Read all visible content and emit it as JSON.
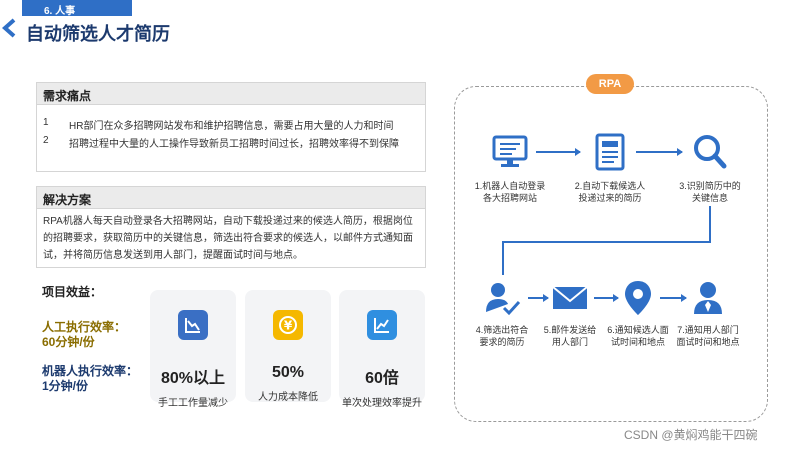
{
  "header": {
    "tag": "6. 人事",
    "title": "自动筛选人才简历"
  },
  "needs": {
    "title": "需求痛点",
    "items": [
      {
        "num": "1",
        "text": "HR部门在众多招聘网站发布和维护招聘信息，需要占用大量的人力和时间"
      },
      {
        "num": "2",
        "text": "招聘过程中大量的人工操作导致新员工招聘时间过长，招聘效率得不到保障"
      }
    ]
  },
  "solution": {
    "title": "解决方案",
    "text": "RPA机器人每天自动登录各大招聘网站，自动下载投递过来的候选人简历，根据岗位的招聘要求，获取简历中的关键信息，筛选出符合要求的候选人，以邮件方式通知面试，并将简历信息发送到用人部门，提醒面试时间与地点。"
  },
  "benefits": {
    "title": "项目效益：",
    "manual": {
      "line1": "人工执行效率：",
      "line2": "60分钟/份"
    },
    "robot": {
      "line1": "机器人执行效率：",
      "line2": "1分钟/份"
    },
    "cards": [
      {
        "value": "80%以上",
        "label": "手工工作量减少",
        "icon": "chart-decline-icon",
        "color": "#3a6fc4"
      },
      {
        "value": "50%",
        "label": "人力成本降低",
        "icon": "yen-coin-icon",
        "color": "#f5b800"
      },
      {
        "value": "60倍",
        "label": "单次处理效率提升",
        "icon": "chart-rise-icon",
        "color": "#2f8fe0"
      }
    ]
  },
  "rpa": {
    "badge": "RPA",
    "steps": [
      {
        "line1": "1.机器人自动登录",
        "line2": "各大招聘网站"
      },
      {
        "line1": "2.自动下载候选人",
        "line2": "投递过来的简历"
      },
      {
        "line1": "3.识别简历中的",
        "line2": "关键信息"
      },
      {
        "line1": "4.筛选出符合",
        "line2": "要求的简历"
      },
      {
        "line1": "5.邮件发送给",
        "line2": "用人部门"
      },
      {
        "line1": "6.通知候选人面",
        "line2": "试时间和地点"
      },
      {
        "line1": "7.通知用人部门",
        "line2": "面试时间和地点"
      }
    ]
  },
  "watermark": "CSDN @黄焖鸡能干四碗",
  "colors": {
    "primary": "#2f6fc6",
    "accent": "#f29a45",
    "title": "#1c3a6e"
  }
}
